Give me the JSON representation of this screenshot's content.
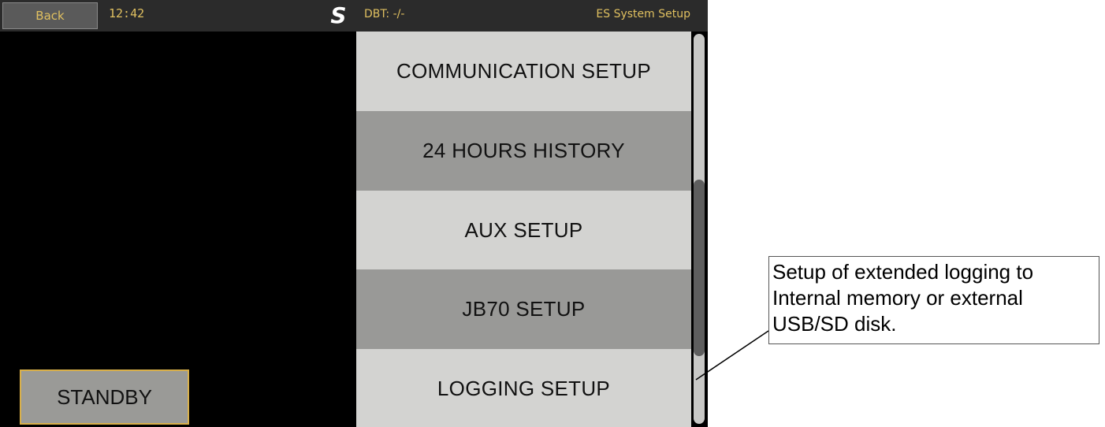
{
  "topbar": {
    "back_label": "Back",
    "time": "12:42",
    "logo": "S",
    "dbt": "DBT: -/-",
    "title": "ES System Setup"
  },
  "menu": {
    "items": [
      {
        "label": "COMMUNICATION SETUP",
        "shade": "light"
      },
      {
        "label": "24 HOURS HISTORY",
        "shade": "dark"
      },
      {
        "label": "AUX SETUP",
        "shade": "light"
      },
      {
        "label": "JB70 SETUP",
        "shade": "dark"
      },
      {
        "label": "LOGGING SETUP",
        "shade": "light"
      }
    ]
  },
  "standby_label": "STANDBY",
  "callout": {
    "text": "Setup of extended logging to Internal memory or external USB/SD disk."
  },
  "colors": {
    "accent_text": "#e0c060",
    "menu_light": "#d3d3d1",
    "menu_dark": "#999997",
    "background": "#000000"
  }
}
